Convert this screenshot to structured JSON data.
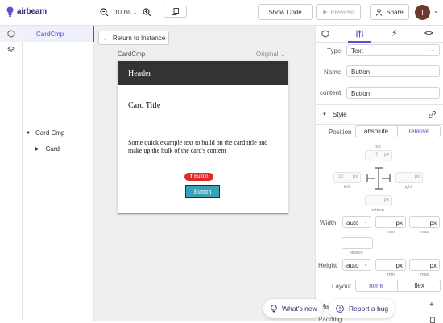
{
  "app": {
    "logo_text": "airbeam"
  },
  "toolbar": {
    "zoom": "100%",
    "show_code_label": "Show Code",
    "preview_label": "Preview",
    "share_label": "Share",
    "avatar_initial": "I"
  },
  "tree": {
    "selected_component": "CardCmp",
    "items": [
      {
        "label": "Card Cmp"
      },
      {
        "label": "Card"
      }
    ]
  },
  "canvas": {
    "return_label": "Return to Instance",
    "frame_title": "CardCmp",
    "frame_mode": "Original",
    "card": {
      "header": "Header",
      "title": "Card Title",
      "text": "Some quick example text to build on the card title and make up the bulk of the card's content",
      "badge": "Button",
      "button": "Button"
    }
  },
  "props": {
    "type_label": "Type",
    "type_value": "Text",
    "name_label": "Name",
    "name_value": "Button",
    "content_label": "content",
    "content_value": "Button",
    "style_title": "Style",
    "position_label": "Position",
    "position_options": [
      "absolute",
      "relative"
    ],
    "top_label": "top",
    "left_label": "left",
    "right_label": "right",
    "bottom_label": "bottom",
    "top_value": "7",
    "left_value": "32",
    "unit_px": "px",
    "width_label": "Width",
    "width_mode": "auto",
    "min_label": "min",
    "max_label": "max",
    "stretch_label": "stretch",
    "height_label": "Height",
    "height_mode": "auto",
    "layout_label": "Layout",
    "layout_options": [
      "none",
      "flex"
    ],
    "margin_label": "Margin",
    "padding_label": "Padding"
  },
  "bottom": {
    "whats_new_label": "What's new",
    "report_bug_label": "Report a bug"
  },
  "colors": {
    "accent": "#5a4fcf",
    "card_header_bg": "#333333",
    "badge_bg": "#e02b2b",
    "button_bg": "#3aa0b5"
  }
}
